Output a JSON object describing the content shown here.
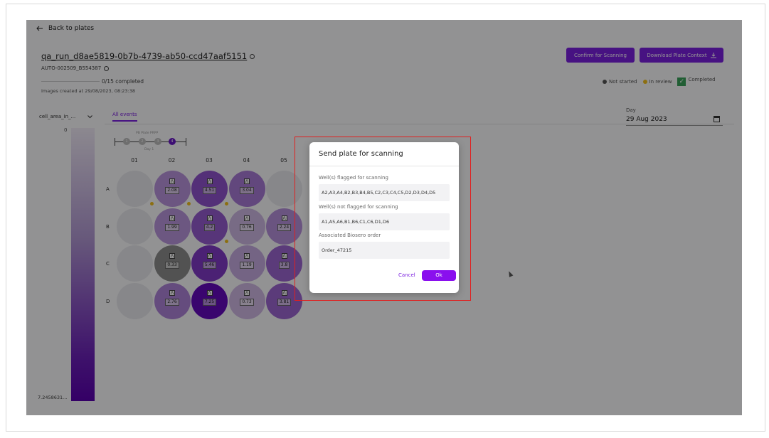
{
  "nav": {
    "back_label": "Back to plates"
  },
  "plate": {
    "title": "qa_run_d8ae5819-0b7b-4739-ab50-ccd47aaf5151",
    "sub_id": "AUTO-002509_B554387",
    "progress_text": "0/15 completed",
    "progress_fraction": 0,
    "images_created": "Images created at 29/08/2023, 08:23:38"
  },
  "actions": {
    "confirm_label": "Confirm for Scanning",
    "download_label": "Download Plate Context"
  },
  "legend": {
    "not_started": "Not started",
    "in_review": "In review",
    "completed": "Completed"
  },
  "colors": {
    "accent": "#7b1fe0",
    "in_review": "#f2c01e",
    "completed": "#3aa35a",
    "not_started": "#bdbdbd"
  },
  "metric": {
    "selected": "cell_area_in_..."
  },
  "tabs": {
    "all_events": "All events"
  },
  "day": {
    "label": "Day",
    "value": "29 Aug 2023"
  },
  "scale": {
    "top_label": "0",
    "bottom_label": "7.2458631..."
  },
  "timeline": {
    "caption": "PB Plate PRPP",
    "day_label": "Day 1",
    "steps": [
      "1",
      "2",
      "3",
      "4"
    ],
    "active_step": 4
  },
  "grid": {
    "columns": [
      "01",
      "02",
      "03",
      "04",
      "05"
    ],
    "rows": [
      "A",
      "B",
      "C",
      "D"
    ],
    "wells": {
      "A": [
        null,
        "2.08",
        "4.51",
        "3.04",
        null
      ],
      "B": [
        null,
        "1.99",
        "4.2",
        "0.76",
        "2.24"
      ],
      "C": [
        null,
        "0.33",
        "5.46",
        "1.19",
        "3.8"
      ],
      "D": [
        null,
        "2.76",
        "7.25",
        "0.73",
        "3.81"
      ]
    }
  },
  "dialog": {
    "title": "Send plate for scanning",
    "flagged_label": "Well(s) flagged for scanning",
    "flagged_value": "A2,A3,A4,B2,B3,B4,B5,C2,C3,C4,C5,D2,D3,D4,D5",
    "not_flagged_label": "Well(s) not flagged for scanning",
    "not_flagged_value": "A1,A5,A6,B1,B6,C1,C6,D1,D6",
    "order_label": "Associated Bioserо order",
    "order_value": "Order_47215",
    "cancel_label": "Cancel",
    "ok_label": "Ok"
  }
}
